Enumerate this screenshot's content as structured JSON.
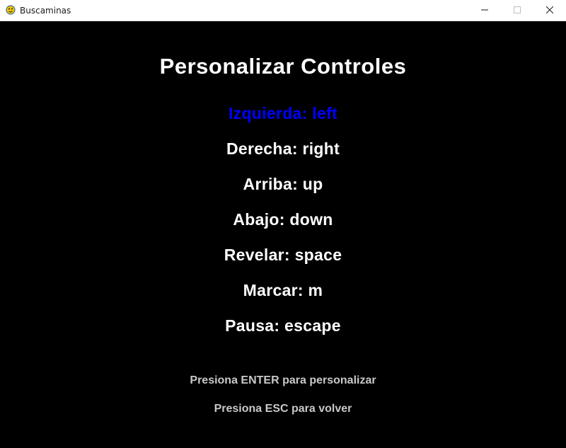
{
  "window": {
    "title": "Buscaminas",
    "icon": "pygame-snake-icon"
  },
  "heading": "Personalizar Controles",
  "controls": [
    {
      "label": "Izquierda: left",
      "selected": true
    },
    {
      "label": "Derecha: right",
      "selected": false
    },
    {
      "label": "Arriba: up",
      "selected": false
    },
    {
      "label": "Abajo: down",
      "selected": false
    },
    {
      "label": "Revelar: space",
      "selected": false
    },
    {
      "label": "Marcar: m",
      "selected": false
    },
    {
      "label": "Pausa: escape",
      "selected": false
    }
  ],
  "hints": {
    "enter": "Presiona ENTER para personalizar",
    "esc": "Presiona ESC para volver"
  },
  "colors": {
    "background": "#000000",
    "text": "#ffffff",
    "selected": "#0000ff",
    "hint": "#c8c8c8"
  }
}
